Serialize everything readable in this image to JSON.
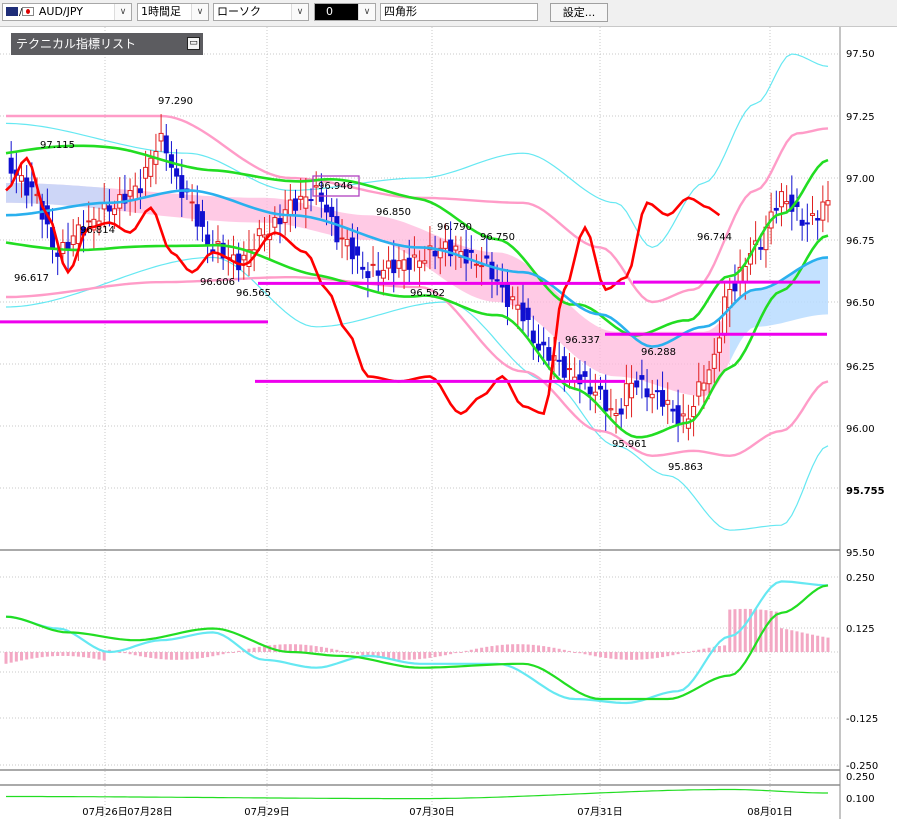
{
  "toolbar": {
    "pair": "AUD/JPY",
    "timeframe": "1時間足",
    "chart_type": "ローソク",
    "color_label": "0",
    "shape": "四角形",
    "settings": "設定..."
  },
  "tech_list": {
    "title": "テクニカル指標リスト"
  },
  "colors": {
    "up_candle": "#e02020",
    "down_candle": "#1010d0",
    "ma_green": "#22dd22",
    "ma_blue": "#2ab0ee",
    "line_red": "#ff0000",
    "band_pink": "#ff9cc8",
    "band_cyan": "#66e8f2",
    "level_magenta": "#ee00ee",
    "pink_fill": "#ffb8dc",
    "blue_fill": "#b8dcff"
  },
  "chart_data": {
    "type": "candlestick",
    "y_axis_labels": [
      "97.50",
      "97.25",
      "97.00",
      "96.75",
      "96.50",
      "96.25",
      "96.00",
      "95.755",
      "95.50"
    ],
    "macd_axis_labels": [
      "0.250",
      "0.125",
      "-0.125",
      "-0.250"
    ],
    "lower_axis_labels": [
      "0.250",
      "0.100"
    ],
    "date_labels": [
      "07月26日",
      "07月28日",
      "07月29日",
      "07月30日",
      "07月31日",
      "08月01日"
    ],
    "annotations": [
      "97.115",
      "97.290",
      "96.617",
      "96.814",
      "96.606",
      "96.565",
      "96.946",
      "96.850",
      "96.790",
      "96.750",
      "96.562",
      "96.337",
      "96.288",
      "95.961",
      "95.863",
      "96.744"
    ],
    "current_price": "95.755",
    "grid": true
  }
}
